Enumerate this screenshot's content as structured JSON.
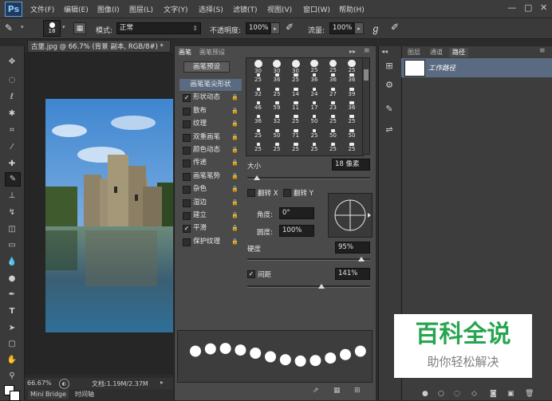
{
  "app_logo": "Ps",
  "menu": [
    "文件(F)",
    "编辑(E)",
    "图像(I)",
    "图层(L)",
    "文字(Y)",
    "选择(S)",
    "滤镜(T)",
    "视图(V)",
    "窗口(W)",
    "帮助(H)"
  ],
  "window_controls": [
    "—",
    "▢",
    "✕"
  ],
  "options_bar": {
    "brush_size": "18",
    "mode_label": "模式:",
    "mode_value": "正常",
    "opacity_label": "不透明度:",
    "opacity_value": "100%",
    "flow_label": "流量:",
    "flow_value": "100%"
  },
  "document": {
    "tab_title": "古堡.jpg @ 66.7% (背景 副本, RGB/8#) *",
    "zoom": "66.67%",
    "doc_size": "文档:1.19M/2.37M"
  },
  "bottom_tabs": [
    "Mini Bridge",
    "时间轴"
  ],
  "brush_panel": {
    "tabs": [
      "画笔",
      "画笔预设"
    ],
    "preset_button": "画笔预设",
    "options": [
      {
        "label": "画笔笔尖形状",
        "checked": false,
        "lock": false,
        "selected": true,
        "header": true
      },
      {
        "label": "形状动态",
        "checked": true,
        "lock": true
      },
      {
        "label": "散布",
        "checked": false,
        "lock": true
      },
      {
        "label": "纹理",
        "checked": false,
        "lock": true
      },
      {
        "label": "双重画笔",
        "checked": false,
        "lock": true
      },
      {
        "label": "颜色动态",
        "checked": false,
        "lock": true
      },
      {
        "label": "传递",
        "checked": false,
        "lock": true
      },
      {
        "label": "画笔笔势",
        "checked": false,
        "lock": true
      },
      {
        "label": "杂色",
        "checked": false,
        "lock": true
      },
      {
        "label": "湿边",
        "checked": false,
        "lock": true
      },
      {
        "label": "建立",
        "checked": false,
        "lock": true
      },
      {
        "label": "平滑",
        "checked": true,
        "lock": true
      },
      {
        "label": "保护纹理",
        "checked": false,
        "lock": true
      }
    ],
    "tip_sizes": [
      [
        "30",
        "30",
        "30",
        "25",
        "25",
        "25"
      ],
      [
        "25",
        "36",
        "25",
        "36",
        "36",
        "36"
      ],
      [
        "32",
        "25",
        "14",
        "24",
        "27",
        "39"
      ],
      [
        "46",
        "59",
        "11",
        "17",
        "23",
        "36"
      ],
      [
        "36",
        "32",
        "25",
        "50",
        "25",
        "25"
      ],
      [
        "25",
        "50",
        "71",
        "25",
        "50",
        "50"
      ],
      [
        "25",
        "25",
        "25",
        "25",
        "25",
        "25"
      ]
    ],
    "size_label": "大小",
    "size_value": "18 像素",
    "size_level": 0.08,
    "flip_x_label": "翻转 X",
    "flip_y_label": "翻转 Y",
    "angle_label": "角度:",
    "angle_value": "0°",
    "roundness_label": "圆度:",
    "roundness_value": "100%",
    "hardness_label": "硬度",
    "hardness_value": "95%",
    "hardness_level": 0.95,
    "spacing_label": "间距",
    "spacing_checked": true,
    "spacing_value": "141%",
    "spacing_level": 0.62,
    "footer_icons": [
      "brush-add-icon",
      "grid-icon",
      "panel-menu-icon"
    ]
  },
  "layers_panel": {
    "tabs": [
      "图层",
      "通道",
      "路径"
    ],
    "active_tab": "路径",
    "paths": [
      {
        "name": "工作路径"
      }
    ]
  },
  "watermark": {
    "title": "百科全说",
    "subtitle": "助你轻松解决"
  }
}
